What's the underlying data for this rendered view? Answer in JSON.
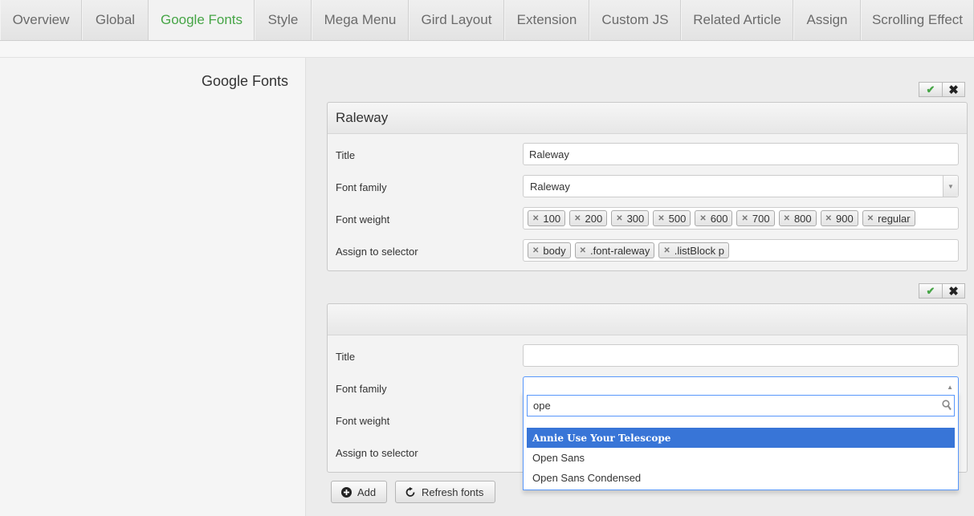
{
  "tabs": [
    {
      "label": "Overview",
      "active": false
    },
    {
      "label": "Global",
      "active": false
    },
    {
      "label": "Google Fonts",
      "active": true
    },
    {
      "label": "Style",
      "active": false
    },
    {
      "label": "Mega Menu",
      "active": false
    },
    {
      "label": "Gird Layout",
      "active": false
    },
    {
      "label": "Extension",
      "active": false
    },
    {
      "label": "Custom JS",
      "active": false
    },
    {
      "label": "Related Article",
      "active": false
    },
    {
      "label": "Assign",
      "active": false
    },
    {
      "label": "Scrolling Effect",
      "active": false
    }
  ],
  "section_title": "Google Fonts",
  "labels": {
    "title": "Title",
    "font_family": "Font family",
    "font_weight": "Font weight",
    "assign_selector": "Assign to selector"
  },
  "font1": {
    "heading": "Raleway",
    "title_value": "Raleway",
    "family_value": "Raleway",
    "weights": [
      "100",
      "200",
      "300",
      "500",
      "600",
      "700",
      "800",
      "900",
      "regular"
    ],
    "selectors": [
      "body",
      ".font-raleway",
      ".listBlock p"
    ]
  },
  "font2": {
    "heading": "",
    "title_value": "",
    "family_value": ""
  },
  "dropdown": {
    "search_value": "ope",
    "results": [
      "Annie Use Your Telescope",
      "Open Sans",
      "Open Sans Condensed"
    ],
    "highlighted_index": 0
  },
  "buttons": {
    "add": "Add",
    "refresh": "Refresh fonts"
  },
  "colors": {
    "active_tab": "#46a546",
    "highlight": "#3875d7",
    "focus_border": "#5897fb"
  }
}
